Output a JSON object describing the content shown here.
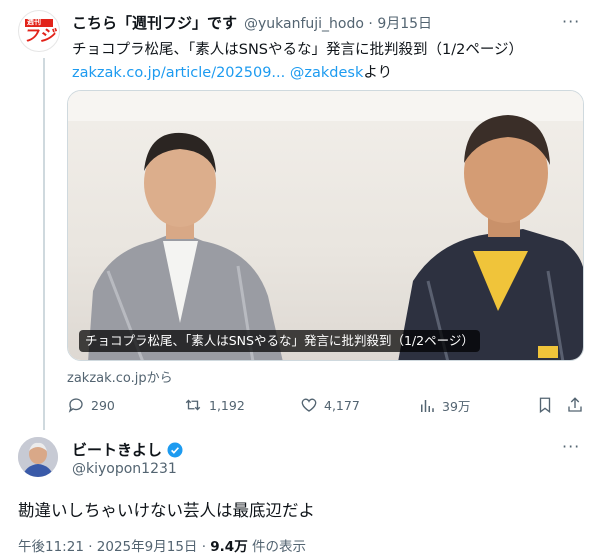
{
  "quoted_tweet": {
    "author_name": "こちら「週刊フジ」です",
    "author_handle": "@yukanfuji_hodo",
    "separator": "·",
    "date": "9月15日",
    "more": "···",
    "avatar_logo_top": "週刊",
    "avatar_logo_main": "フジ",
    "text": "チョコプラ松尾、「素人はSNSやるな」発言に批判殺到（1/2ページ）",
    "link_url": "zakzak.co.jp/article/202509...",
    "link_mention": "@zakdesk",
    "link_suffix": "より",
    "card_caption": "チョコプラ松尾、「素人はSNSやるな」発言に批判殺到（1/2ページ）",
    "card_source": "zakzak.co.jpから",
    "actions": {
      "replies": "290",
      "retweets": "1,192",
      "likes": "4,177",
      "views": "39万"
    }
  },
  "main_tweet": {
    "author_name": "ビートきよし",
    "author_handle": "@kiyopon1231",
    "more": "···",
    "text": "勘違いしちゃいけない芸人は最底辺だよ",
    "time": "午後11:21 · 2025年9月15日 · ",
    "views_count": "9.4万",
    "views_label": " 件の表示"
  },
  "colors": {
    "link": "#1d9bf0",
    "secondary": "#536471",
    "verified": "#1d9bf0",
    "brand_red": "#e2231a"
  }
}
